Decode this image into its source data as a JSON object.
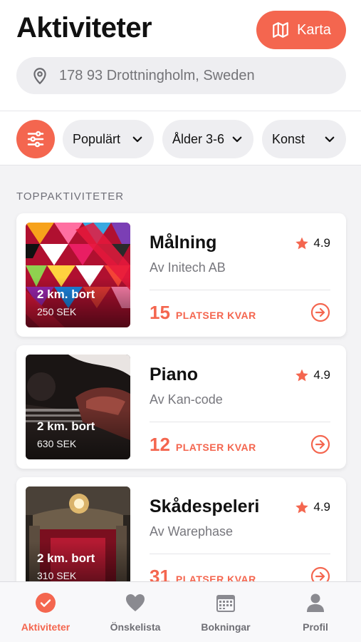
{
  "header": {
    "title": "Aktiviteter",
    "map_button_label": "Karta",
    "location": "178 93 Drottningholm, Sweden"
  },
  "filters": {
    "icon": "sliders-icon",
    "chips": [
      {
        "label": "Populärt"
      },
      {
        "label": "Ålder 3-6"
      },
      {
        "label": "Konst"
      }
    ]
  },
  "section": {
    "title": "TOPPAKTIVITETER"
  },
  "activities": [
    {
      "title": "Målning",
      "organizer": "Av Initech AB",
      "rating": "4.9",
      "distance": "2 km. bort",
      "price": "250 SEK",
      "spots_left": "15",
      "spots_label": "PLATSER KVAR"
    },
    {
      "title": "Piano",
      "organizer": "Av Kan-code",
      "rating": "4.9",
      "distance": "2 km. bort",
      "price": "630 SEK",
      "spots_left": "12",
      "spots_label": "PLATSER KVAR"
    },
    {
      "title": "Skådespeleri",
      "organizer": "Av Warephase",
      "rating": "4.9",
      "distance": "2 km. bort",
      "price": "310 SEK",
      "spots_left": "31",
      "spots_label": "PLATSER KVAR"
    }
  ],
  "tabbar": {
    "tabs": [
      {
        "label": "Aktiviteter",
        "icon": "check-circle-icon",
        "active": true
      },
      {
        "label": "Önskelista",
        "icon": "heart-icon",
        "active": false
      },
      {
        "label": "Bokningar",
        "icon": "calendar-icon",
        "active": false
      },
      {
        "label": "Profil",
        "icon": "person-icon",
        "active": false
      }
    ]
  },
  "colors": {
    "accent": "#f4664f",
    "chip_bg": "#eeeef1",
    "page_bg": "#f3f3f5"
  }
}
